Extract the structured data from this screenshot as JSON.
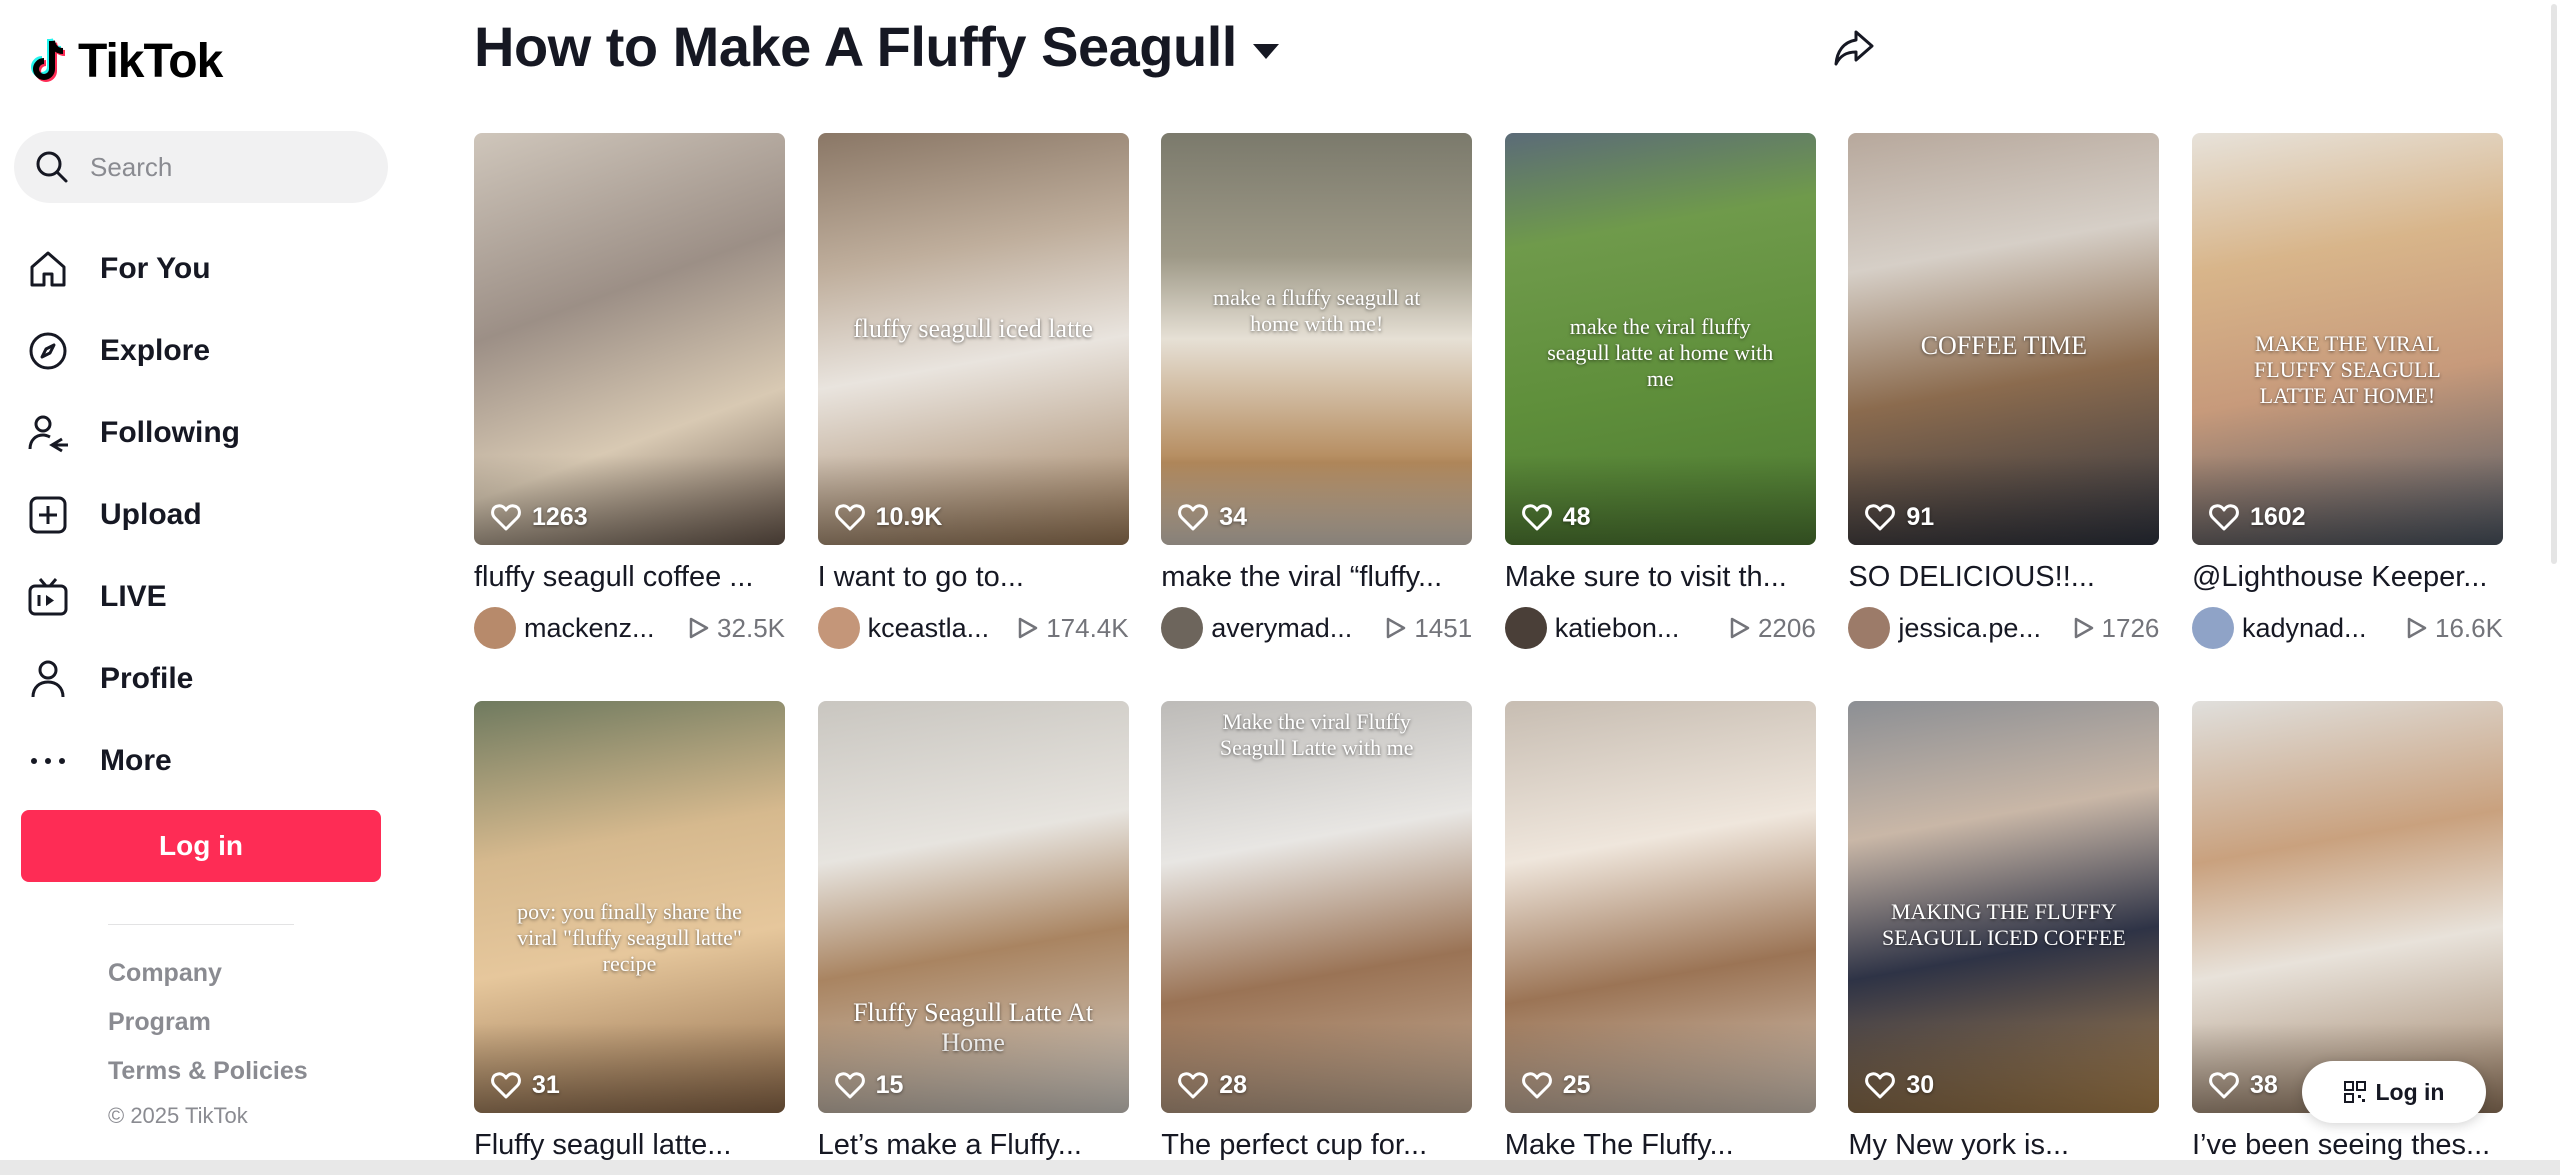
{
  "brand": {
    "name": "TikTok",
    "accent": "#fe2c55",
    "cyan": "#25f4ee"
  },
  "search": {
    "placeholder": "Search"
  },
  "nav": [
    {
      "label": "For You",
      "icon": "home-icon"
    },
    {
      "label": "Explore",
      "icon": "compass-icon"
    },
    {
      "label": "Following",
      "icon": "following-icon"
    },
    {
      "label": "Upload",
      "icon": "upload-icon"
    },
    {
      "label": "LIVE",
      "icon": "live-icon"
    },
    {
      "label": "Profile",
      "icon": "profile-icon"
    },
    {
      "label": "More",
      "icon": "more-icon"
    }
  ],
  "login_label": "Log in",
  "footer": {
    "links": [
      "Company",
      "Program",
      "Terms & Policies"
    ],
    "copyright": "© 2025 TikTok"
  },
  "page_title": "How to Make A Fluffy Seagull",
  "videos": [
    {
      "likes": "1263",
      "title": "fluffy seagull coffee ...",
      "user": "mackenz...",
      "views": "32.5K",
      "overlay": "",
      "bg": "linear-gradient(160deg,#cfc6bb 0%,#9c8f86 40%,#d8c9b3 70%,#6b5a4e 100%)",
      "avatar": "#b78a6b"
    },
    {
      "likes": "10.9K",
      "title": "I want to go to...",
      "user": "kceastla...",
      "views": "174.4K",
      "overlay": "fluffy seagull iced latte",
      "bg": "linear-gradient(170deg,#8a7766 0%,#bfae9c 30%,#e9e4de 55%,#9c7a57 100%)",
      "avatar": "#c49679"
    },
    {
      "likes": "34",
      "title": "make the viral “fluffy...",
      "user": "averymad...",
      "views": "1451",
      "overlay": "make a fluffy seagull at home with me!",
      "bg": "linear-gradient(180deg,#7b7a6c 0%,#9e9987 30%,#e6e0d5 50%,#b48a5c 80%,#d9cfc3 100%)",
      "avatar": "#6d655c"
    },
    {
      "likes": "48",
      "title": "Make sure to visit th...",
      "user": "katiebon...",
      "views": "2206",
      "overlay": "make the viral fluffy seagull latte at home with me",
      "bg": "linear-gradient(170deg,#5b6b78 0%,#6f9a4b 25%,#5f8f3b 60%,#4e7a33 100%)",
      "avatar": "#4a3f38"
    },
    {
      "likes": "91",
      "title": "SO DELICIOUS!!...",
      "user": "jessica.pe...",
      "views": "1726",
      "overlay": "COFFEE TIME",
      "bg": "linear-gradient(170deg,#b7a89c 0%,#d6cfc7 30%,#8b6b4e 60%,#2f3440 100%)",
      "avatar": "#9c7b69"
    },
    {
      "likes": "1602",
      "title": "@Lighthouse Keeper...",
      "user": "kadynad...",
      "views": "16.6K",
      "overlay": "MAKE THE VIRAL FLUFFY SEAGULL LATTE AT HOME!",
      "bg": "linear-gradient(170deg,#e7e2da 0%,#d8b58a 30%,#c79a7b 60%,#4c5663 100%)",
      "avatar": "#8fa3c7"
    },
    {
      "likes": "31",
      "title": "Fluffy seagull latte...",
      "user": "",
      "views": "",
      "overlay": "pov: you finally share the viral \"fluffy seagull latte\" recipe",
      "bg": "linear-gradient(170deg,#6f7a5f 0%,#d6b98e 35%,#e6c79c 60%,#8e6a4a 100%)",
      "avatar": ""
    },
    {
      "likes": "15",
      "title": "Let’s make a Fluffy...",
      "user": "",
      "views": "",
      "overlay": "Fluffy Seagull Latte At Home",
      "bg": "linear-gradient(170deg,#c9c6c0 0%,#e7e4df 35%,#a98461 60%,#d8d3cc 100%)",
      "avatar": ""
    },
    {
      "likes": "28",
      "title": "The perfect cup for...",
      "user": "",
      "views": "",
      "overlay": "Make the viral Fluffy Seagull Latte with me",
      "bg": "linear-gradient(170deg,#bdbbb8 0%,#e8e6e3 35%,#9a7355 65%,#c7b09a 100%)",
      "avatar": ""
    },
    {
      "likes": "25",
      "title": "Make The Fluffy...",
      "user": "",
      "views": "",
      "overlay": "",
      "bg": "linear-gradient(170deg,#c7bdb2 0%,#efe6dc 35%,#9b7455 65%,#d9cbbd 100%)",
      "avatar": ""
    },
    {
      "likes": "30",
      "title": "My New york is...",
      "user": "",
      "views": "",
      "overlay": "MAKING THE FLUFFY SEAGULL ICED COFFEE",
      "bg": "linear-gradient(170deg,#8c8f94 0%,#c9b7a7 30%,#2e3346 60%,#b2874f 100%)",
      "avatar": ""
    },
    {
      "likes": "38",
      "title": "I’ve been seeing thes...",
      "user": "",
      "views": "",
      "overlay": "",
      "bg": "linear-gradient(170deg,#e0dfdc 0%,#c9a17e 35%,#e8e2da 60%,#9a7d62 100%)",
      "avatar": ""
    }
  ],
  "float_login_label": "Log in"
}
